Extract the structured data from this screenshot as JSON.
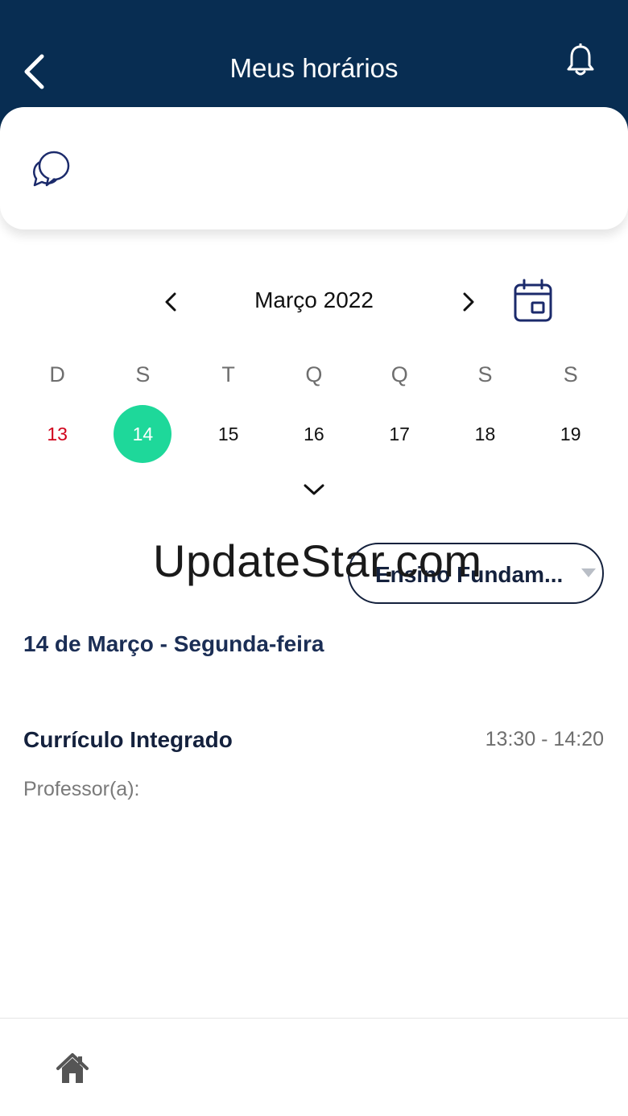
{
  "header": {
    "title": "Meus horários",
    "back_icon": "chevron-left-icon",
    "notification_icon": "bell-icon"
  },
  "card": {
    "icon": "chat-bubbles-icon"
  },
  "calendar": {
    "month_label": "Março 2022",
    "weekdays": [
      "D",
      "S",
      "T",
      "Q",
      "Q",
      "S",
      "S"
    ],
    "dates": [
      "13",
      "14",
      "15",
      "16",
      "17",
      "18",
      "19"
    ],
    "selected_date": "14",
    "selected_color": "#1ed89a",
    "sunday_color": "#d0021b"
  },
  "watermark": "UpdateStar.com",
  "filter": {
    "value": "Ensino Fundam..."
  },
  "schedule": {
    "day_heading": "14 de Março - Segunda-feira",
    "items": [
      {
        "name": "Currículo Integrado",
        "time": "13:30 - 14:20",
        "teacher_label": "Professor(a):"
      }
    ]
  },
  "colors": {
    "header_bg": "#082d52",
    "primary_text": "#14213d"
  },
  "nav": {
    "home_icon": "home-icon"
  }
}
